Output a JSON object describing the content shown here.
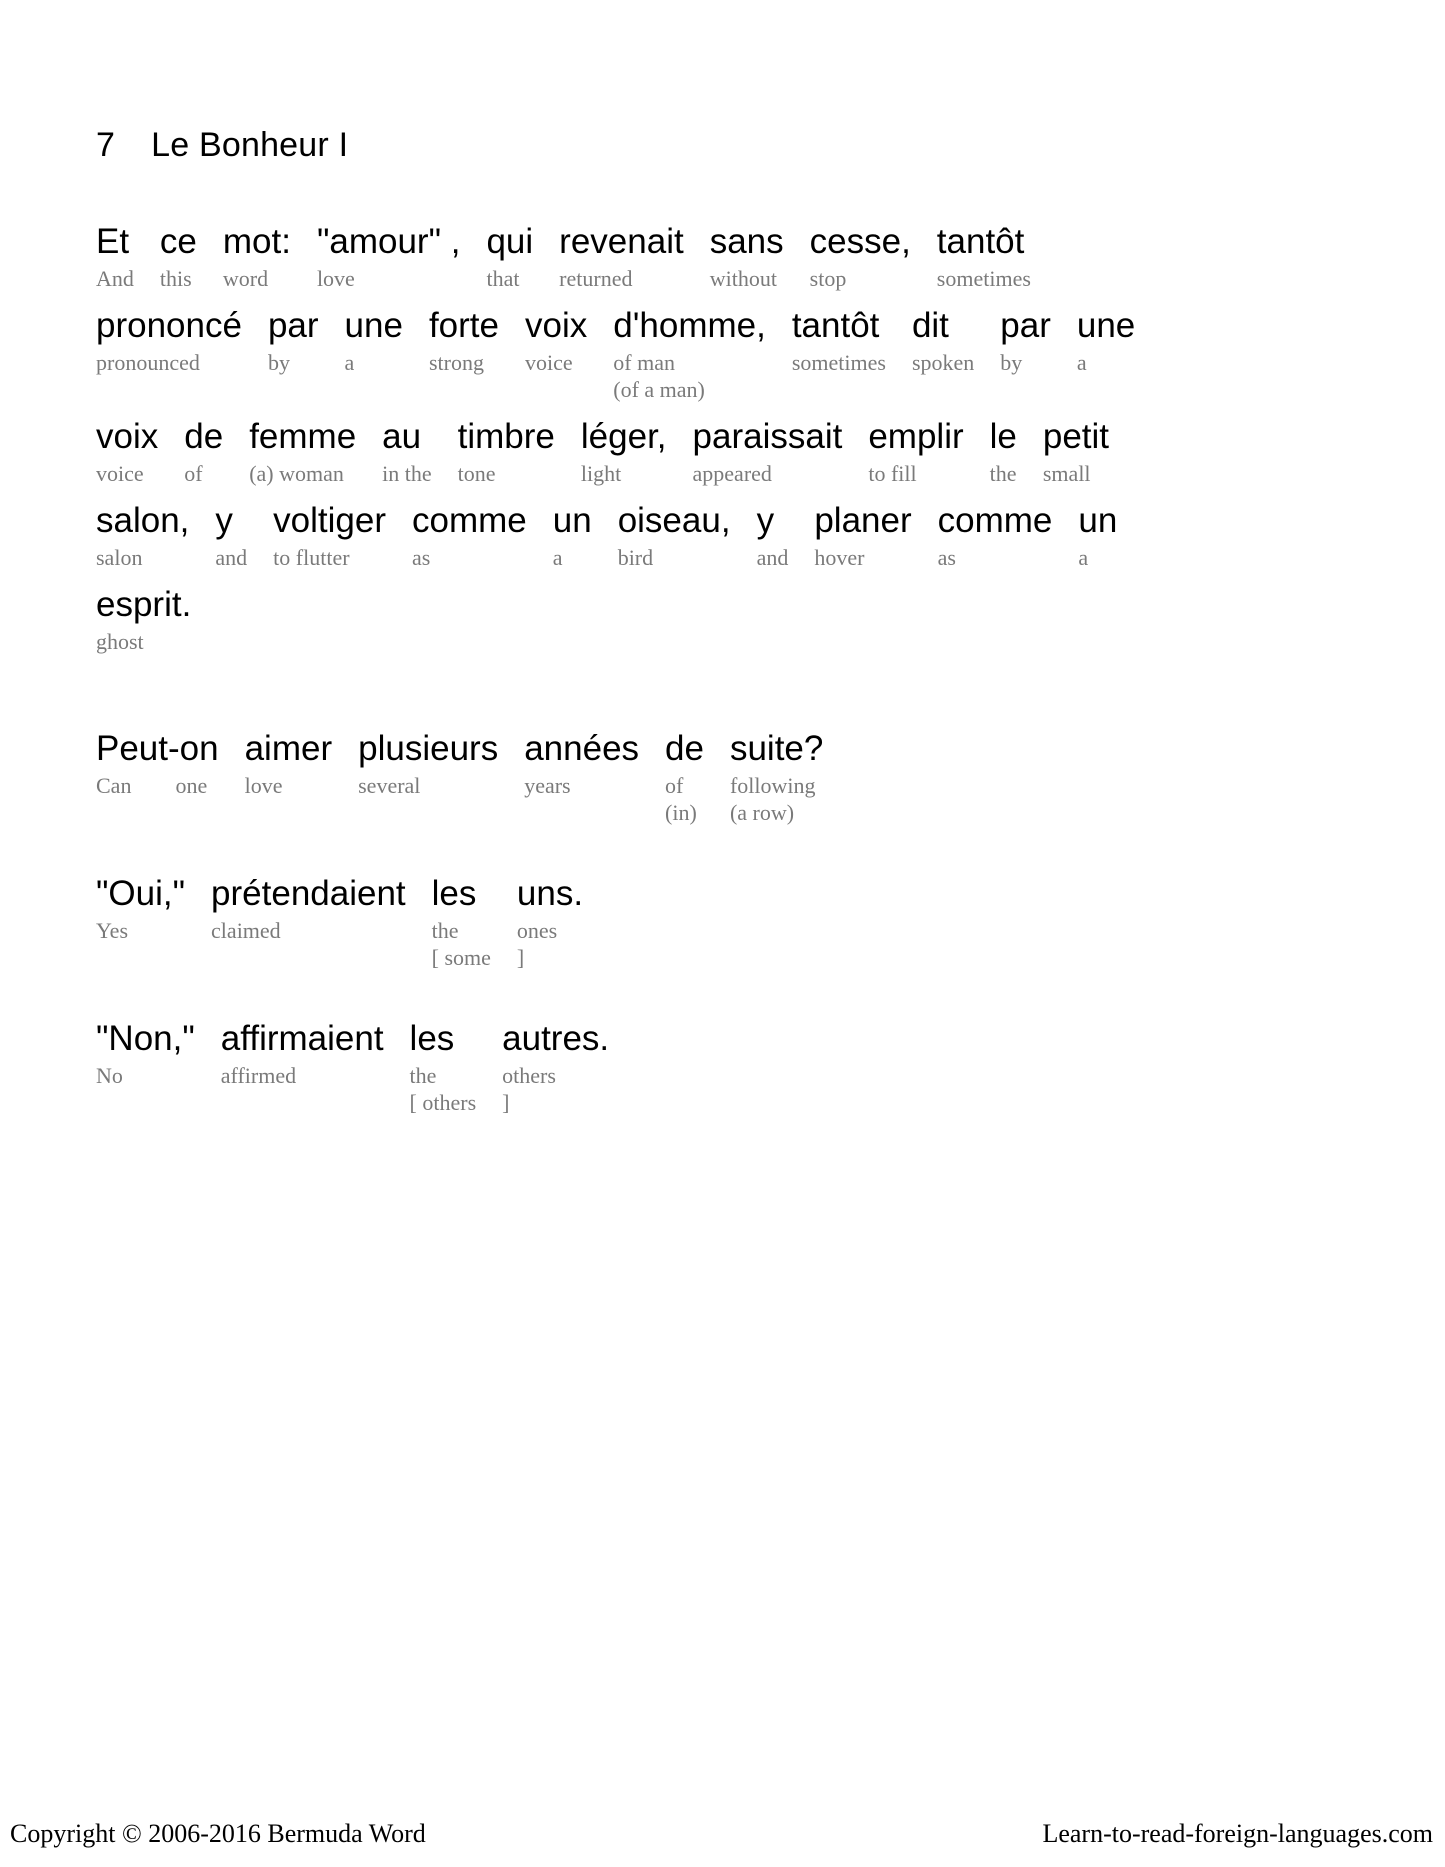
{
  "document": {
    "title_number": "7",
    "title_text": "Le Bonheur I",
    "gloss_color": "#7a7a7a",
    "text_color": "#000000",
    "background_color": "#ffffff"
  },
  "footer": {
    "copyright": "Copyright © 2006-2016 Bermuda Word",
    "website": "Learn-to-read-foreign-languages.com"
  },
  "stanzas": [
    {
      "id": "stanza-1",
      "lines": [
        {
          "id": "line-1",
          "words": [
            {
              "word": "Et",
              "gloss": [
                "And"
              ]
            },
            {
              "word": "ce",
              "gloss": [
                "this"
              ]
            },
            {
              "word": "mot:",
              "gloss": [
                "word"
              ]
            },
            {
              "word": "\"amour\" ,",
              "gloss": [
                "love"
              ]
            },
            {
              "word": "qui",
              "gloss": [
                "that"
              ]
            },
            {
              "word": "revenait",
              "gloss": [
                "returned"
              ]
            },
            {
              "word": "sans",
              "gloss": [
                "without"
              ]
            },
            {
              "word": "cesse,",
              "gloss": [
                "stop"
              ]
            },
            {
              "word": "tantôt",
              "gloss": [
                "sometimes"
              ]
            }
          ]
        },
        {
          "id": "line-2",
          "words": [
            {
              "word": "prononcé",
              "gloss": [
                "pronounced"
              ]
            },
            {
              "word": "par",
              "gloss": [
                "by"
              ]
            },
            {
              "word": "une",
              "gloss": [
                "a"
              ]
            },
            {
              "word": "forte",
              "gloss": [
                "strong"
              ]
            },
            {
              "word": "voix",
              "gloss": [
                "voice"
              ]
            },
            {
              "word": "d'homme,",
              "gloss": [
                "of man",
                "(of a man)"
              ]
            },
            {
              "word": "tantôt",
              "gloss": [
                "sometimes"
              ]
            },
            {
              "word": "dit",
              "gloss": [
                "spoken"
              ]
            },
            {
              "word": "par",
              "gloss": [
                "by"
              ]
            },
            {
              "word": "une",
              "gloss": [
                "a"
              ]
            }
          ]
        },
        {
          "id": "line-3",
          "words": [
            {
              "word": "voix",
              "gloss": [
                "voice"
              ]
            },
            {
              "word": "de",
              "gloss": [
                "of"
              ]
            },
            {
              "word": "femme",
              "gloss": [
                "(a) woman"
              ]
            },
            {
              "word": "au",
              "gloss": [
                "in the"
              ]
            },
            {
              "word": "timbre",
              "gloss": [
                "tone"
              ]
            },
            {
              "word": "léger,",
              "gloss": [
                "light"
              ]
            },
            {
              "word": "paraissait",
              "gloss": [
                "appeared"
              ]
            },
            {
              "word": "emplir",
              "gloss": [
                "to fill"
              ]
            },
            {
              "word": "le",
              "gloss": [
                "the"
              ]
            },
            {
              "word": "petit",
              "gloss": [
                "small"
              ]
            }
          ]
        },
        {
          "id": "line-4",
          "words": [
            {
              "word": "salon,",
              "gloss": [
                "salon"
              ]
            },
            {
              "word": "y",
              "gloss": [
                "and"
              ]
            },
            {
              "word": "voltiger",
              "gloss": [
                "to flutter"
              ]
            },
            {
              "word": "comme",
              "gloss": [
                "as"
              ]
            },
            {
              "word": "un",
              "gloss": [
                "a"
              ]
            },
            {
              "word": "oiseau,",
              "gloss": [
                "bird"
              ]
            },
            {
              "word": "y",
              "gloss": [
                "and"
              ]
            },
            {
              "word": "planer",
              "gloss": [
                "hover"
              ]
            },
            {
              "word": "comme",
              "gloss": [
                "as"
              ]
            },
            {
              "word": "un",
              "gloss": [
                "a"
              ]
            }
          ]
        },
        {
          "id": "line-5",
          "words": [
            {
              "word": "esprit.",
              "gloss": [
                "ghost"
              ]
            }
          ]
        }
      ]
    },
    {
      "id": "stanza-2",
      "lines": [
        {
          "id": "line-6",
          "words": [
            {
              "word": "Peut-on",
              "gloss": [
                "Can        one"
              ]
            },
            {
              "word": "aimer",
              "gloss": [
                "love"
              ]
            },
            {
              "word": "plusieurs",
              "gloss": [
                "several"
              ]
            },
            {
              "word": "années",
              "gloss": [
                "years"
              ]
            },
            {
              "word": "de",
              "gloss": [
                "of",
                "(in)"
              ]
            },
            {
              "word": "suite?",
              "gloss": [
                "following",
                "(a row)"
              ]
            }
          ]
        }
      ]
    },
    {
      "id": "stanza-3",
      "lines": [
        {
          "id": "line-7",
          "words": [
            {
              "word": "\"Oui,\"",
              "gloss": [
                "Yes"
              ]
            },
            {
              "word": "prétendaient",
              "gloss": [
                "claimed"
              ]
            },
            {
              "word": "les",
              "gloss": [
                "the",
                "[ some"
              ]
            },
            {
              "word": "uns.",
              "gloss": [
                "ones",
                "]"
              ]
            }
          ]
        }
      ]
    },
    {
      "id": "stanza-4",
      "lines": [
        {
          "id": "line-8",
          "words": [
            {
              "word": "\"Non,\"",
              "gloss": [
                "No"
              ]
            },
            {
              "word": "affirmaient",
              "gloss": [
                "affirmed"
              ]
            },
            {
              "word": "les",
              "gloss": [
                "the",
                "[ others"
              ]
            },
            {
              "word": "autres.",
              "gloss": [
                "others",
                "]"
              ]
            }
          ]
        }
      ]
    }
  ]
}
